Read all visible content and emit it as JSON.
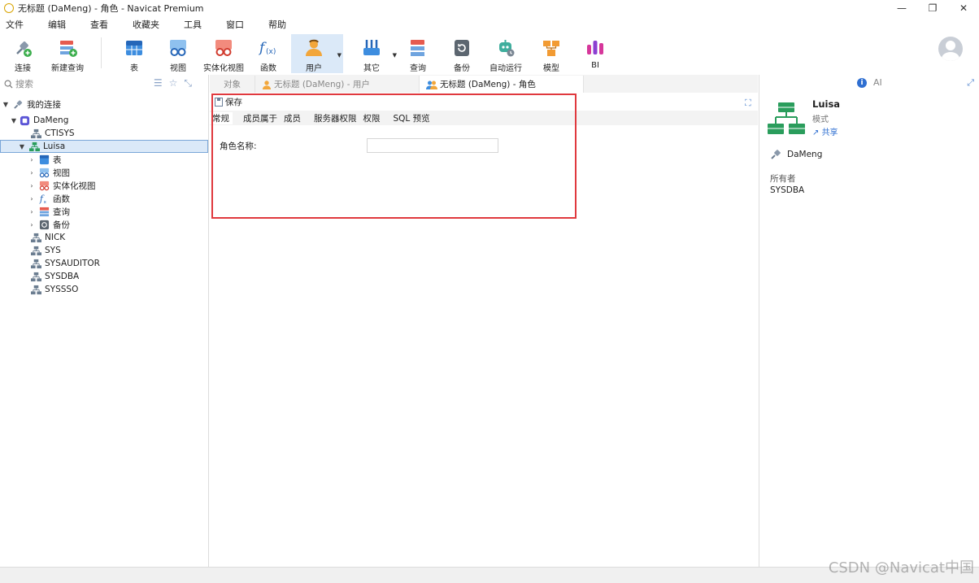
{
  "window": {
    "title": "无标题 (DaMeng) - 角色 - Navicat Premium",
    "controls": [
      "—",
      "❐",
      "✕"
    ]
  },
  "menu": [
    "文件",
    "编辑",
    "查看",
    "收藏夹",
    "工具",
    "窗口",
    "帮助"
  ],
  "toolbar": {
    "buttons": [
      {
        "label": "连接",
        "icon": "plug-icon"
      },
      {
        "label": "新建查询",
        "icon": "new-query-icon"
      },
      {
        "label": "表",
        "icon": "table-icon"
      },
      {
        "label": "视图",
        "icon": "view-icon"
      },
      {
        "label": "实体化视图",
        "icon": "materialized-view-icon"
      },
      {
        "label": "函数",
        "icon": "function-icon"
      },
      {
        "label": "用户",
        "icon": "user-icon",
        "active": true
      },
      {
        "label": "其它",
        "icon": "other-icon"
      },
      {
        "label": "查询",
        "icon": "query-icon"
      },
      {
        "label": "备份",
        "icon": "backup-icon"
      },
      {
        "label": "自动运行",
        "icon": "automation-icon"
      },
      {
        "label": "模型",
        "icon": "model-icon"
      },
      {
        "label": "BI",
        "icon": "bi-icon"
      }
    ]
  },
  "sidebar": {
    "search_placeholder": "搜索",
    "root": "我的连接",
    "connection": "DaMeng",
    "schemas_before": [
      "CTISYS"
    ],
    "selected_schema": "Luisa",
    "children": [
      {
        "label": "表",
        "icon": "table-icon"
      },
      {
        "label": "视图",
        "icon": "view-icon"
      },
      {
        "label": "实体化视图",
        "icon": "materialized-view-icon"
      },
      {
        "label": "函数",
        "icon": "function-icon"
      },
      {
        "label": "查询",
        "icon": "query-icon"
      },
      {
        "label": "备份",
        "icon": "backup-icon"
      }
    ],
    "schemas_after": [
      "NICK",
      "SYS",
      "SYSAUDITOR",
      "SYSDBA",
      "SYSSSO"
    ]
  },
  "tabs": [
    {
      "label": "对象"
    },
    {
      "label": "无标题 (DaMeng) - 用户"
    },
    {
      "label": "无标题 (DaMeng) - 角色",
      "active": true
    }
  ],
  "editor": {
    "save_label": "保存",
    "subtabs": [
      "常规",
      "成员属于",
      "成员",
      "服务器权限",
      "权限",
      "SQL 预览"
    ],
    "role_name_label": "角色名称:",
    "role_name_value": ""
  },
  "info_panel": {
    "ai_label": "AI",
    "name": "Luisa",
    "type": "模式",
    "share": "共享",
    "connection": "DaMeng",
    "owner_label": "所有者",
    "owner_value": "SYSDBA"
  },
  "watermark": "CSDN @Navicat中国"
}
